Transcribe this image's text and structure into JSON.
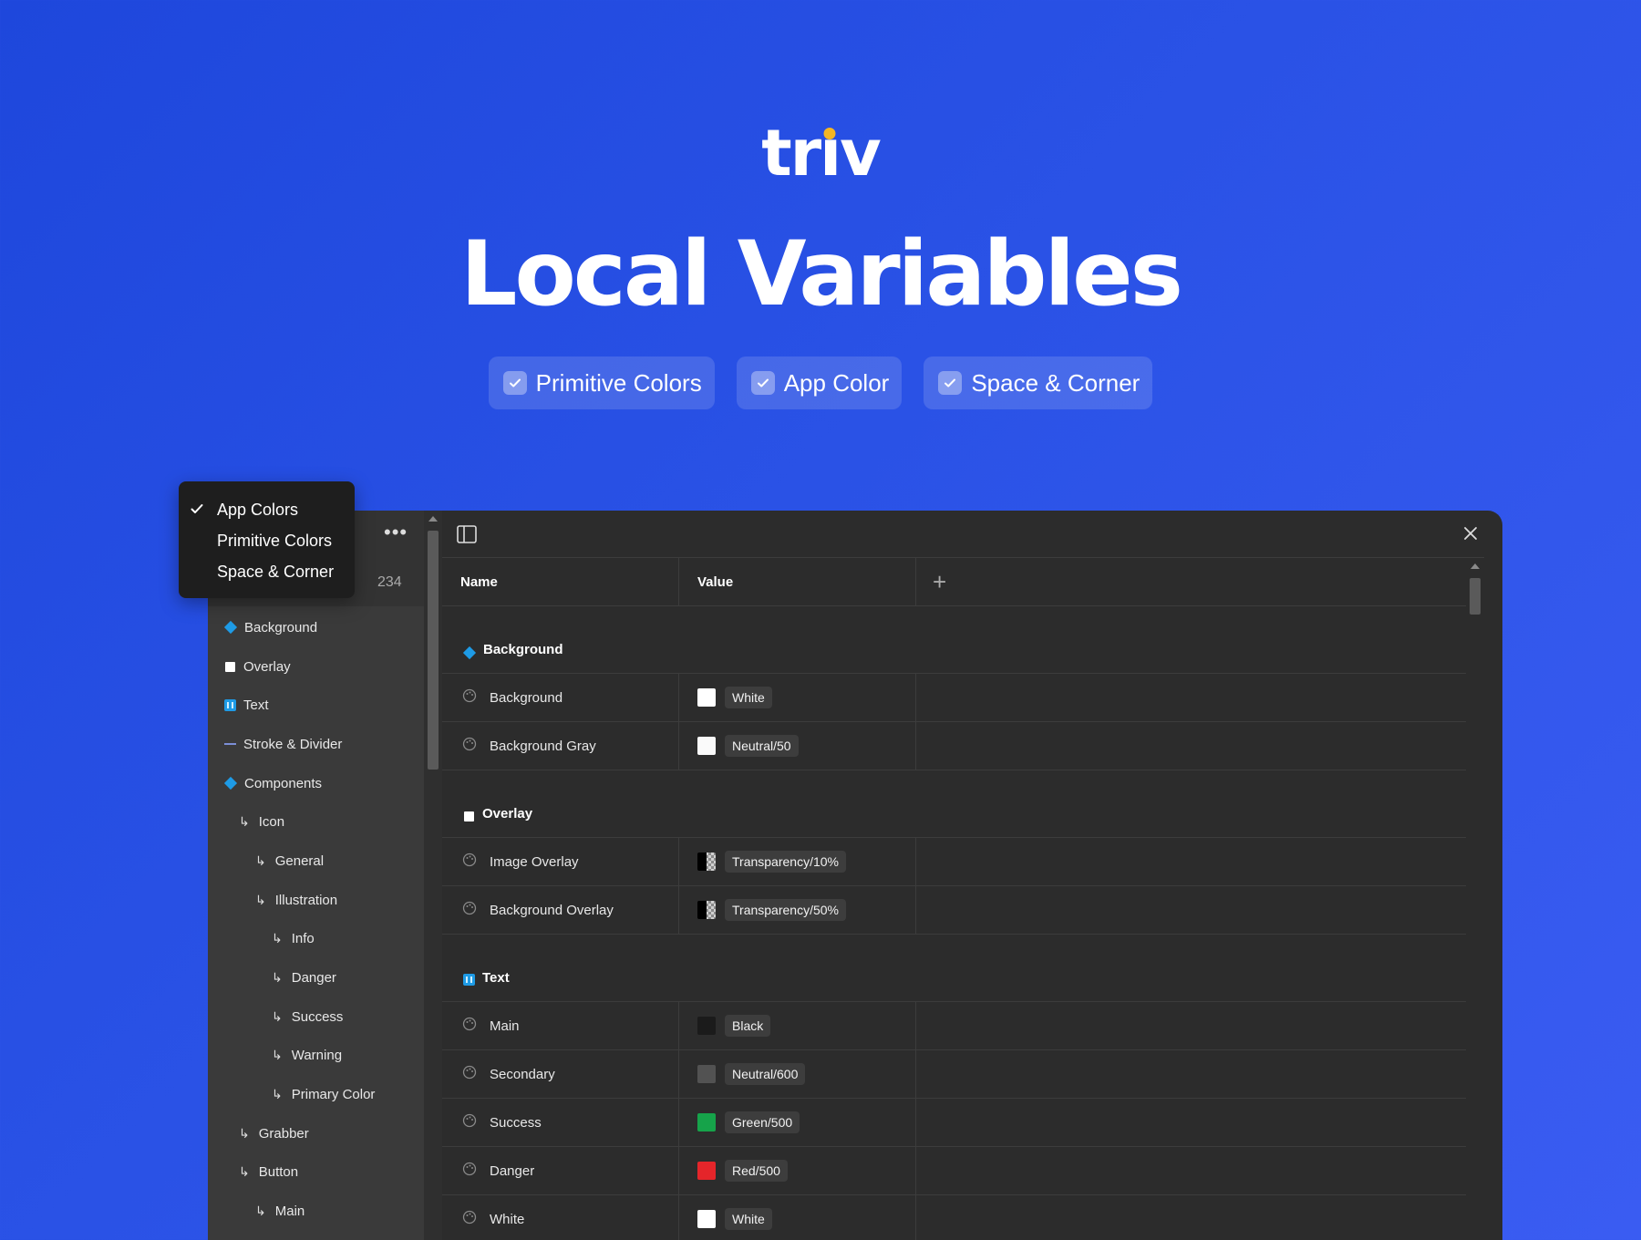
{
  "hero": {
    "logo": "triv",
    "logo_parts": [
      "tr",
      "ı",
      "v"
    ],
    "headline": "Local Variables",
    "pills": [
      "Primitive Colors",
      "App Color",
      "Space & Corner"
    ],
    "logo_dot_color": "#f5b623"
  },
  "dropdown": {
    "items": [
      {
        "label": "App Colors",
        "checked": true
      },
      {
        "label": "Primitive Colors",
        "checked": false
      },
      {
        "label": "Space & Corner",
        "checked": false
      }
    ]
  },
  "sidebar": {
    "count": "234",
    "items": [
      {
        "label": "Background",
        "icon": "diamond-icon",
        "depth": 0
      },
      {
        "label": "Overlay",
        "icon": "square-icon",
        "depth": 0
      },
      {
        "label": "Text",
        "icon": "text-icon",
        "depth": 0
      },
      {
        "label": "Stroke & Divider",
        "icon": "line-icon",
        "depth": 0
      },
      {
        "label": "Components",
        "icon": "diamond-icon",
        "depth": 0
      },
      {
        "label": "Icon",
        "icon": "arrow",
        "depth": 1
      },
      {
        "label": "General",
        "icon": "arrow",
        "depth": 2
      },
      {
        "label": "Illustration",
        "icon": "arrow",
        "depth": 2
      },
      {
        "label": "Info",
        "icon": "arrow",
        "depth": 3
      },
      {
        "label": "Danger",
        "icon": "arrow",
        "depth": 3
      },
      {
        "label": "Success",
        "icon": "arrow",
        "depth": 3
      },
      {
        "label": "Warning",
        "icon": "arrow",
        "depth": 3
      },
      {
        "label": "Primary Color",
        "icon": "arrow",
        "depth": 3
      },
      {
        "label": "Grabber",
        "icon": "arrow",
        "depth": 1
      },
      {
        "label": "Button",
        "icon": "arrow",
        "depth": 1
      },
      {
        "label": "Main",
        "icon": "arrow",
        "depth": 2
      }
    ]
  },
  "table": {
    "headers": {
      "name": "Name",
      "value": "Value"
    },
    "groups": [
      {
        "title": "Background",
        "icon": "diamond-icon",
        "rows": [
          {
            "name": "Background",
            "swatch": "#ffffff",
            "value": "White"
          },
          {
            "name": "Background Gray",
            "swatch": "#fafafa",
            "value": "Neutral/50"
          }
        ]
      },
      {
        "title": "Overlay",
        "icon": "square-icon",
        "rows": [
          {
            "name": "Image Overlay",
            "swatch": "transparent",
            "value": "Transparency/10%"
          },
          {
            "name": "Background Overlay",
            "swatch": "transparent",
            "value": "Transparency/50%"
          }
        ]
      },
      {
        "title": "Text",
        "icon": "text-icon",
        "rows": [
          {
            "name": "Main",
            "swatch": "#1b1b1b",
            "value": "Black"
          },
          {
            "name": "Secondary",
            "swatch": "#525252",
            "value": "Neutral/600"
          },
          {
            "name": "Success",
            "swatch": "#16a34a",
            "value": "Green/500"
          },
          {
            "name": "Danger",
            "swatch": "#e5252a",
            "value": "Red/500"
          },
          {
            "name": "White",
            "swatch": "#ffffff",
            "value": "White"
          }
        ]
      }
    ]
  },
  "colors": {
    "bg_start": "#1e47dc",
    "bg_end": "#3a5cf2",
    "accent_blue": "#1e9be6",
    "window_bg": "#2c2c2c",
    "sidebar_bg": "#3a3a3a"
  }
}
